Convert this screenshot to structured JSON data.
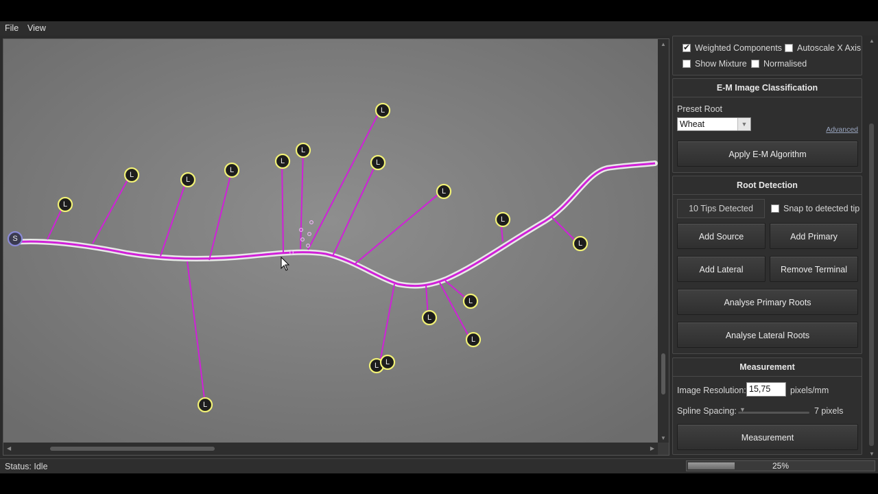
{
  "menu": {
    "file": "File",
    "view": "View"
  },
  "display_options": {
    "weighted_components": {
      "label": "Weighted Components",
      "checked": true
    },
    "autoscale_x": {
      "label": "Autoscale X Axis",
      "checked": false
    },
    "show_mixture": {
      "label": "Show Mixture",
      "checked": false
    },
    "normalised": {
      "label": "Normalised",
      "checked": false
    }
  },
  "em": {
    "title": "E-M Image Classification",
    "preset_label": "Preset Root",
    "preset_value": "Wheat",
    "advanced_link": "Advanced",
    "apply_button": "Apply E-M Algorithm"
  },
  "root_detection": {
    "title": "Root Detection",
    "tips_detected": "10 Tips Detected",
    "snap_label": "Snap to detected tip",
    "snap_checked": false,
    "add_source": "Add Source",
    "add_primary": "Add Primary",
    "add_lateral": "Add Lateral",
    "remove_terminal": "Remove Terminal",
    "analyse_primary": "Analyse Primary Roots",
    "analyse_lateral": "Analyse Lateral Roots"
  },
  "measurement": {
    "title": "Measurement",
    "resolution_label": "Image Resolution:",
    "resolution_value": "15,75",
    "resolution_unit": "pixels/mm",
    "spline_label": "Spline Spacing:",
    "spline_value": "7 pixels",
    "measure_button": "Measurement"
  },
  "canvas": {
    "source_marker": "S",
    "lateral_marker": "L"
  },
  "status": {
    "text": "Status: Idle"
  },
  "progress": {
    "percent": 25,
    "label": "25%"
  },
  "colors": {
    "trace": "#d020d8",
    "marker_ring": "#f2f276",
    "background": "#2b2b2b"
  }
}
